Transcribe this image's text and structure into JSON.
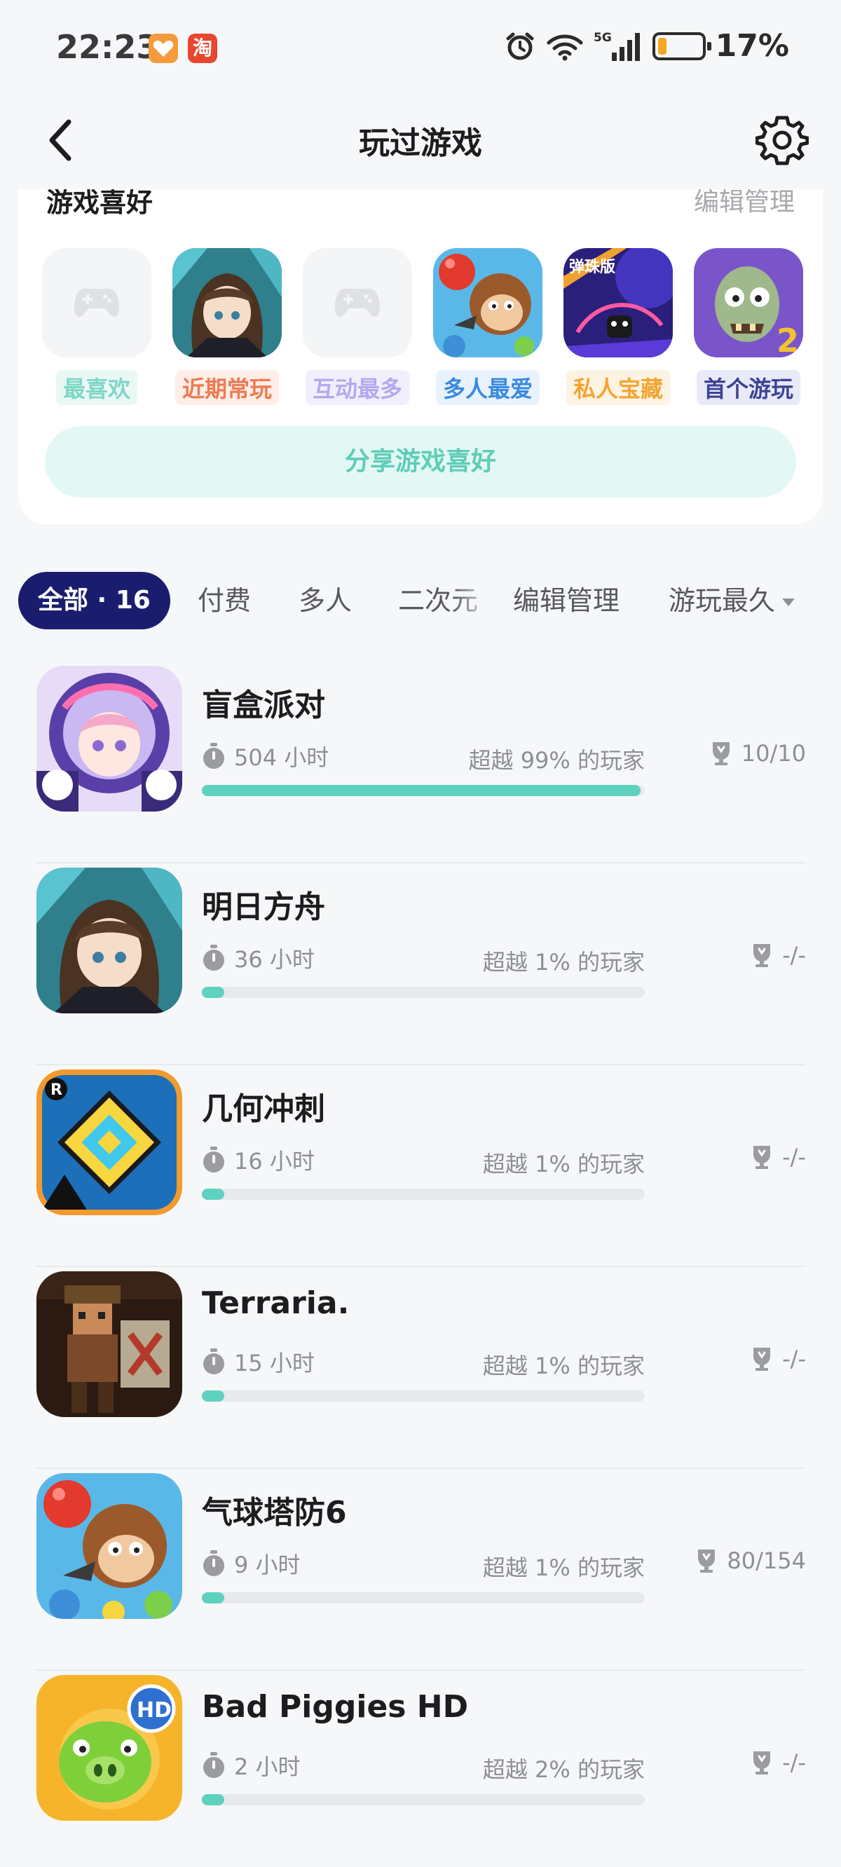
{
  "status_bar": {
    "time": "22:23",
    "taobao_badge": "淘",
    "battery": "17%",
    "battery_level": 0.17,
    "icons": [
      "alarm-icon",
      "wifi-icon",
      "signal-5g-icon",
      "battery-icon"
    ]
  },
  "nav": {
    "title": "玩过游戏",
    "back_icon": "chevron-left-icon",
    "settings_icon": "gear-icon"
  },
  "preferences": {
    "title": "游戏喜好",
    "manage": "编辑管理",
    "share_button": "分享游戏喜好",
    "items": [
      {
        "label": "最喜欢",
        "color": "#7fd7c6",
        "bg": "#eaf8f5",
        "icon": "gamepad-placeholder-icon"
      },
      {
        "label": "近期常玩",
        "color": "#ef7a52",
        "bg": "#fdeee7",
        "icon": "arknights-icon"
      },
      {
        "label": "互动最多",
        "color": "#b3a9f0",
        "bg": "#f1effc",
        "icon": "gamepad-placeholder-icon"
      },
      {
        "label": "多人最爱",
        "color": "#3a8ae0",
        "bg": "#e8f2fd",
        "icon": "bloons-td6-icon"
      },
      {
        "label": "私人宝藏",
        "color": "#f4a531",
        "bg": "#fdf3e3",
        "icon": "pinball-icon"
      },
      {
        "label": "首个游玩",
        "color": "#3e4396",
        "bg": "#e9eaf7",
        "icon": "plants-vs-zombies-icon"
      }
    ]
  },
  "filters": {
    "all": "全部 · 16",
    "tabs": [
      "付费",
      "多人",
      "二次元",
      "编辑管理"
    ],
    "sort": "游玩最久"
  },
  "games": [
    {
      "name": "盲盒派对",
      "time": "504 小时",
      "rank": "超越 99% 的玩家",
      "achievements": "10/10",
      "progress": 0.99,
      "icon": "blind-box-party-icon"
    },
    {
      "name": "明日方舟",
      "time": "36 小时",
      "rank": "超越 1% 的玩家",
      "achievements": "-/-",
      "progress": 0.01,
      "icon": "arknights-icon"
    },
    {
      "name": "几何冲刺",
      "time": "16 小时",
      "rank": "超越 1% 的玩家",
      "achievements": "-/-",
      "progress": 0.01,
      "icon": "geometry-dash-icon"
    },
    {
      "name": "Terraria.",
      "time": "15 小时",
      "rank": "超越 1% 的玩家",
      "achievements": "-/-",
      "progress": 0.01,
      "icon": "terraria-icon"
    },
    {
      "name": "气球塔防6",
      "time": "9 小时",
      "rank": "超越 1% 的玩家",
      "achievements": "80/154",
      "progress": 0.01,
      "icon": "bloons-td6-icon"
    },
    {
      "name": "Bad Piggies HD",
      "time": "2 小时",
      "rank": "超越 2% 的玩家",
      "achievements": "-/-",
      "progress": 0.02,
      "icon": "bad-piggies-hd-icon"
    }
  ]
}
